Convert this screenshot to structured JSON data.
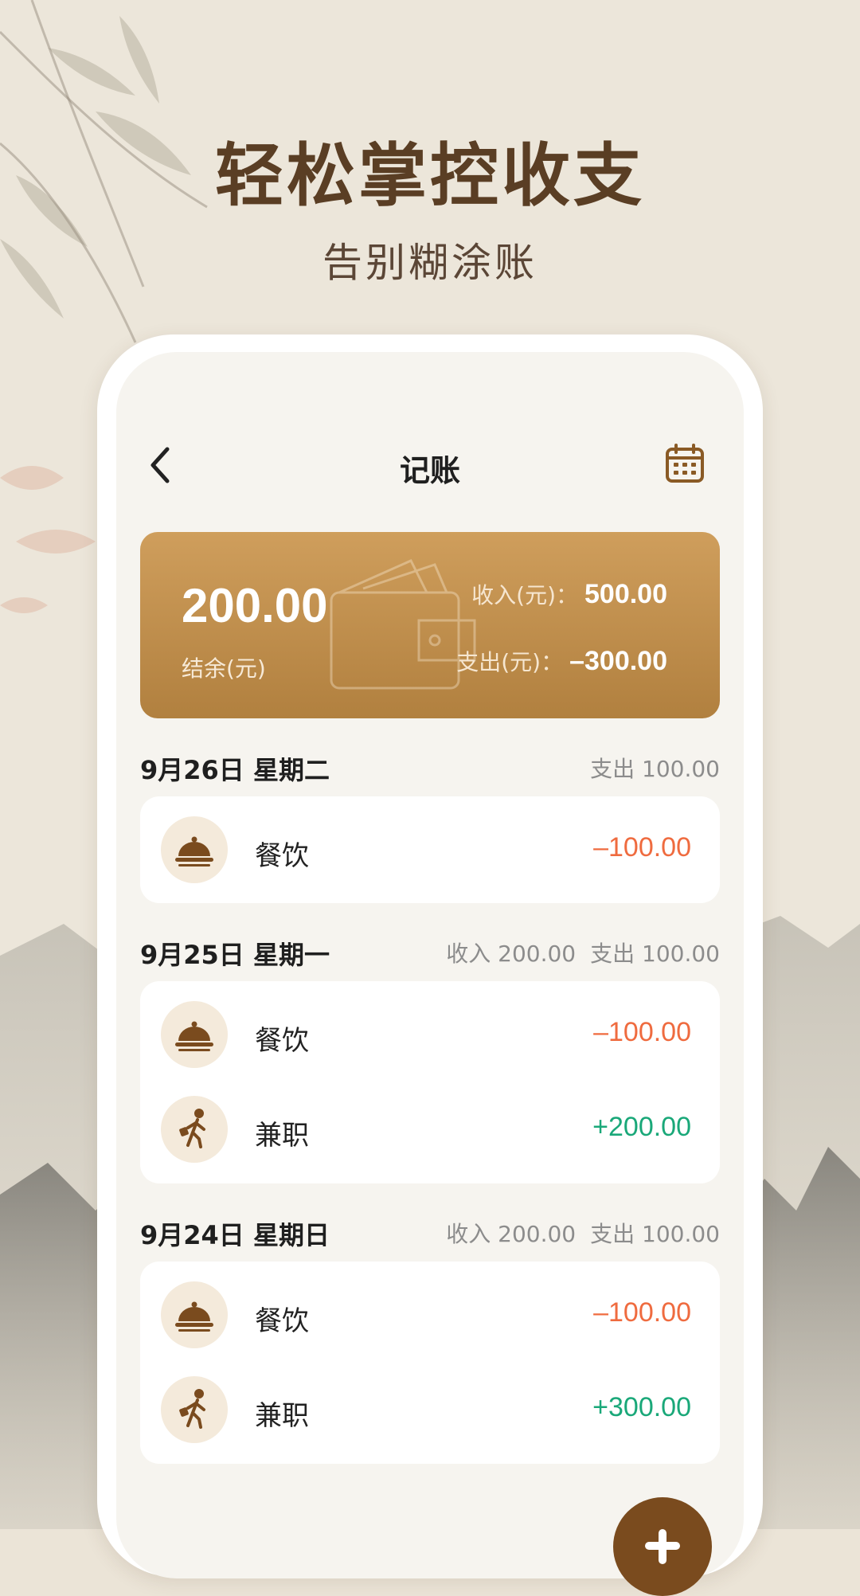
{
  "promo": {
    "headline": "轻松掌控收支",
    "subline": "告别糊涂账"
  },
  "nav": {
    "back_icon": "chevron-left-icon",
    "title": "记账",
    "calendar_icon": "calendar-icon"
  },
  "summary": {
    "balance": "200.00",
    "balance_label": "结余(元)",
    "income_label": "收入(元)：",
    "income_value": "500.00",
    "expense_label": "支出(元)：",
    "expense_value": "–300.00"
  },
  "days": [
    {
      "date": "9月26日  星期二",
      "income": "",
      "expense": "支出 100.00",
      "items": [
        {
          "icon": "food-cloche-icon",
          "name": "餐饮",
          "amount": "–100.00",
          "kind": "neg"
        }
      ]
    },
    {
      "date": "9月25日  星期一",
      "income": "收入 200.00",
      "expense": "支出 100.00",
      "items": [
        {
          "icon": "food-cloche-icon",
          "name": "餐饮",
          "amount": "–100.00",
          "kind": "neg"
        },
        {
          "icon": "walking-worker-icon",
          "name": "兼职",
          "amount": "+200.00",
          "kind": "pos"
        }
      ]
    },
    {
      "date": "9月24日  星期日",
      "income": "收入 200.00",
      "expense": "支出 100.00",
      "items": [
        {
          "icon": "food-cloche-icon",
          "name": "餐饮",
          "amount": "–100.00",
          "kind": "neg"
        },
        {
          "icon": "walking-worker-icon",
          "name": "兼职",
          "amount": "+300.00",
          "kind": "pos"
        }
      ]
    }
  ],
  "fab": {
    "icon": "plus-icon"
  },
  "colors": {
    "accent_brown": "#7a4b1e",
    "card_gold_top": "#cf9e5c",
    "card_gold_bottom": "#b1803f",
    "expense": "#ef6b3f",
    "income": "#1aa879",
    "icon_bg": "#f4eadb"
  }
}
